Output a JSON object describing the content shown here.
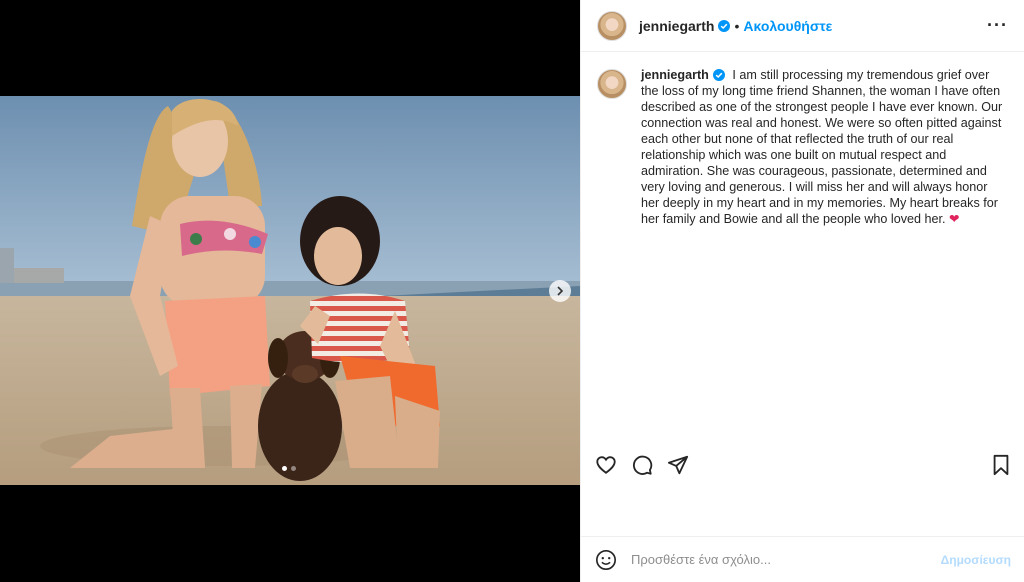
{
  "post": {
    "username": "jenniegarth",
    "separator": "•",
    "follow_label": "Ακολουθήστε",
    "more_icon": "more-horizontal-icon",
    "image_alt": "Two women in swimsuits kneeling on a beach with a brown dog",
    "carousel": {
      "count": 2,
      "active": 1
    }
  },
  "caption": {
    "username": "jenniegarth",
    "text": "I am still processing my tremendous grief over the loss of my long time friend Shannen, the woman I have often described as one of the strongest people I have ever known. Our connection was real and honest. We were so often pitted against each other but none of that reflected the truth of our real relationship which was one built on mutual respect and admiration. She was courageous, passionate, determined and very loving and generous. I will miss her and will always honor her deeply in my heart and in my memories. My heart breaks for her family and Bowie and all the people who loved her.",
    "emoji": "❤"
  },
  "actions": {
    "like_icon": "heart-icon",
    "comment_icon": "comment-icon",
    "share_icon": "share-icon",
    "save_icon": "bookmark-icon"
  },
  "comment": {
    "placeholder": "Προσθέστε ένα σχόλιο...",
    "post_label": "Δημοσίευση",
    "emoji_icon": "smiley-icon"
  },
  "colors": {
    "accent": "#0095f6",
    "verified": "#0095f6",
    "heart": "#e0245e",
    "post_disabled": "#b3dbff"
  }
}
